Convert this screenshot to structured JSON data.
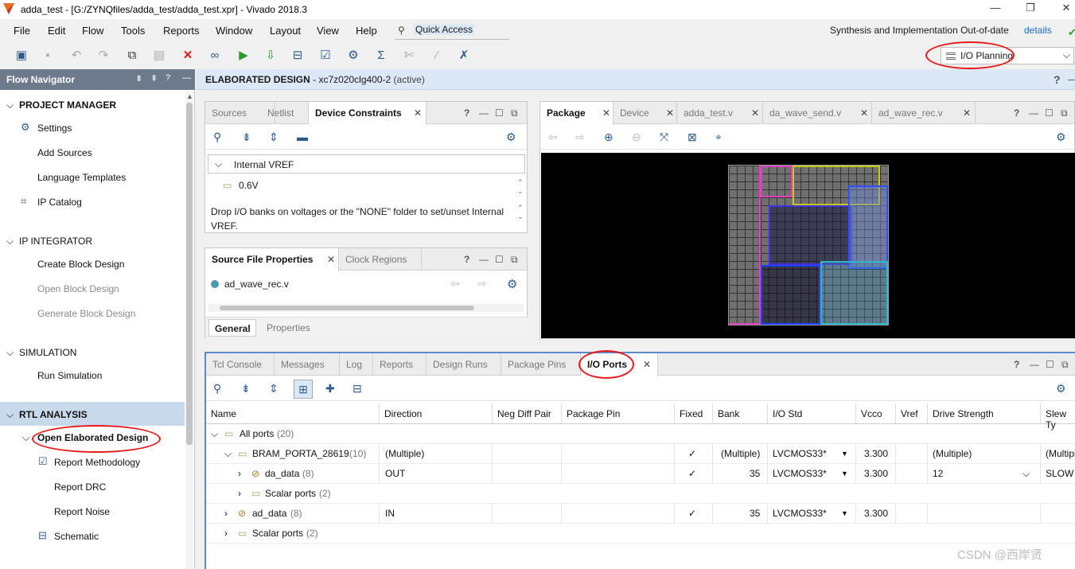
{
  "window": {
    "title": "adda_test - [G:/ZYNQfiles/adda_test/adda_test.xpr] - Vivado 2018.3"
  },
  "menu": [
    "File",
    "Edit",
    "Flow",
    "Tools",
    "Reports",
    "Window",
    "Layout",
    "View",
    "Help"
  ],
  "quick_access": "Quick Access",
  "status": {
    "text": "Synthesis and Implementation Out-of-date",
    "link": "details"
  },
  "layout_select": "I/O Planning",
  "flow_navigator": {
    "title": "Flow Navigator",
    "sections": {
      "project_manager": "PROJECT MANAGER",
      "settings": "Settings",
      "add_sources": "Add Sources",
      "language_templates": "Language Templates",
      "ip_catalog": "IP Catalog",
      "ip_integrator": "IP INTEGRATOR",
      "create_block": "Create Block Design",
      "open_block": "Open Block Design",
      "generate_block": "Generate Block Design",
      "simulation": "SIMULATION",
      "run_simulation": "Run Simulation",
      "rtl_analysis": "RTL ANALYSIS",
      "open_elaborated": "Open Elaborated Design",
      "report_methodology": "Report Methodology",
      "report_drc": "Report DRC",
      "report_noise": "Report Noise",
      "schematic": "Schematic"
    }
  },
  "design_header": {
    "title": "ELABORATED DESIGN",
    "part": " - xc7z020clg400-2",
    "state": "(active)"
  },
  "constraints_panel": {
    "tabs": [
      "Sources",
      "Netlist",
      "Device Constraints"
    ],
    "group": "Internal VREF",
    "item": "0.6V",
    "hint": "Drop I/O banks on voltages or the \"NONE\" folder to set/unset Internal VREF."
  },
  "props_panel": {
    "tabs": [
      "Source File Properties",
      "Clock Regions"
    ],
    "file": "ad_wave_rec.v",
    "bottom_tabs": [
      "General",
      "Properties"
    ]
  },
  "package_panel": {
    "tabs": [
      "Package",
      "Device",
      "adda_test.v",
      "da_wave_send.v",
      "ad_wave_rec.v"
    ]
  },
  "console": {
    "tabs": [
      "Tcl Console",
      "Messages",
      "Log",
      "Reports",
      "Design Runs",
      "Package Pins",
      "I/O Ports"
    ],
    "columns": [
      "Name",
      "Direction",
      "Neg Diff Pair",
      "Package Pin",
      "Fixed",
      "Bank",
      "I/O Std",
      "Vcco",
      "Vref",
      "Drive Strength",
      "Slew Ty"
    ],
    "rows": [
      {
        "name": "All ports",
        "count": "(20)",
        "direction": "",
        "fixed": "",
        "bank": "",
        "iostd": "",
        "vcco": "",
        "drive": "",
        "slew": ""
      },
      {
        "name": "BRAM_PORTA_28619",
        "count": "(10)",
        "direction": "(Multiple)",
        "fixed": "✓",
        "bank": "(Multiple)",
        "iostd": "LVCMOS33*",
        "vcco": "3.300",
        "drive": "(Multiple)",
        "slew": "(Multipl"
      },
      {
        "name": "da_data",
        "count": "(8)",
        "direction": "OUT",
        "fixed": "✓",
        "bank": "35",
        "iostd": "LVCMOS33*",
        "vcco": "3.300",
        "drive": "12",
        "slew": "SLOW"
      },
      {
        "name": "Scalar ports",
        "count": "(2)",
        "direction": "",
        "fixed": "",
        "bank": "",
        "iostd": "",
        "vcco": "",
        "drive": "",
        "slew": ""
      },
      {
        "name": "ad_data",
        "count": "(8)",
        "direction": "IN",
        "fixed": "✓",
        "bank": "35",
        "iostd": "LVCMOS33*",
        "vcco": "3.300",
        "drive": "",
        "slew": ""
      },
      {
        "name": "Scalar ports",
        "count": "(2)",
        "direction": "",
        "fixed": "",
        "bank": "",
        "iostd": "",
        "vcco": "",
        "drive": "",
        "slew": ""
      }
    ]
  },
  "watermark": "CSDN @西岸贤",
  "colors": {
    "accent": "#1d68c8",
    "annotation": "#e81818",
    "nav_header": "#6c7a8c",
    "selected": "#c9d9ec"
  }
}
